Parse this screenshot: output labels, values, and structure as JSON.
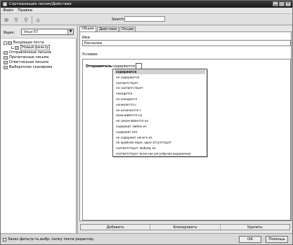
{
  "window": {
    "title": "Сортировщик писем/Действия"
  },
  "menu": [
    "Файл",
    "Правка"
  ],
  "toolbar": {
    "search_label": "Search:",
    "search_value": "",
    "icons": [
      "add-filter-icon",
      "filter-icon",
      "filter-icon",
      "delete-icon"
    ]
  },
  "left": {
    "account_label": "Ящик:",
    "account_value": "linux-57",
    "folders": [
      {
        "label": "Входящая почта",
        "expander": "-"
      },
      {
        "label": "Новый фильтр"
      },
      {
        "label": "Отправленные письма"
      },
      {
        "label": "Прочитанные письма"
      },
      {
        "label": "Ответченные письма"
      },
      {
        "label": "Выборочное сканирова"
      }
    ]
  },
  "tabs": [
    "Общие",
    "Действия",
    "Опции"
  ],
  "rule": {
    "name_label": "Имя:",
    "name_value": "Рассылки",
    "condition_label": "Условие:",
    "field": "Отправитель",
    "operator": "содержится"
  },
  "dropdown": {
    "options": [
      "содержится",
      "не содержится",
      "соответствует",
      "не соответствует",
      "находится",
      "не находится",
      "начинается с",
      "не начинается с",
      "оканчивается на",
      "не заканчивается на",
      "содержит любое из",
      "содержит все",
      "не содержит ничего из",
      "по крайней мере, одно отсутствует",
      "соответствует любому из",
      "соответствует всем как регулярное выражение"
    ]
  },
  "actions": [
    "Добавить",
    "Блокировать",
    "Удалить"
  ],
  "footer": {
    "checkbox_label": "Занес.фильтр-ть.выбр. папку после редактир.",
    "ok": "OK",
    "cancel": "Помощь"
  }
}
